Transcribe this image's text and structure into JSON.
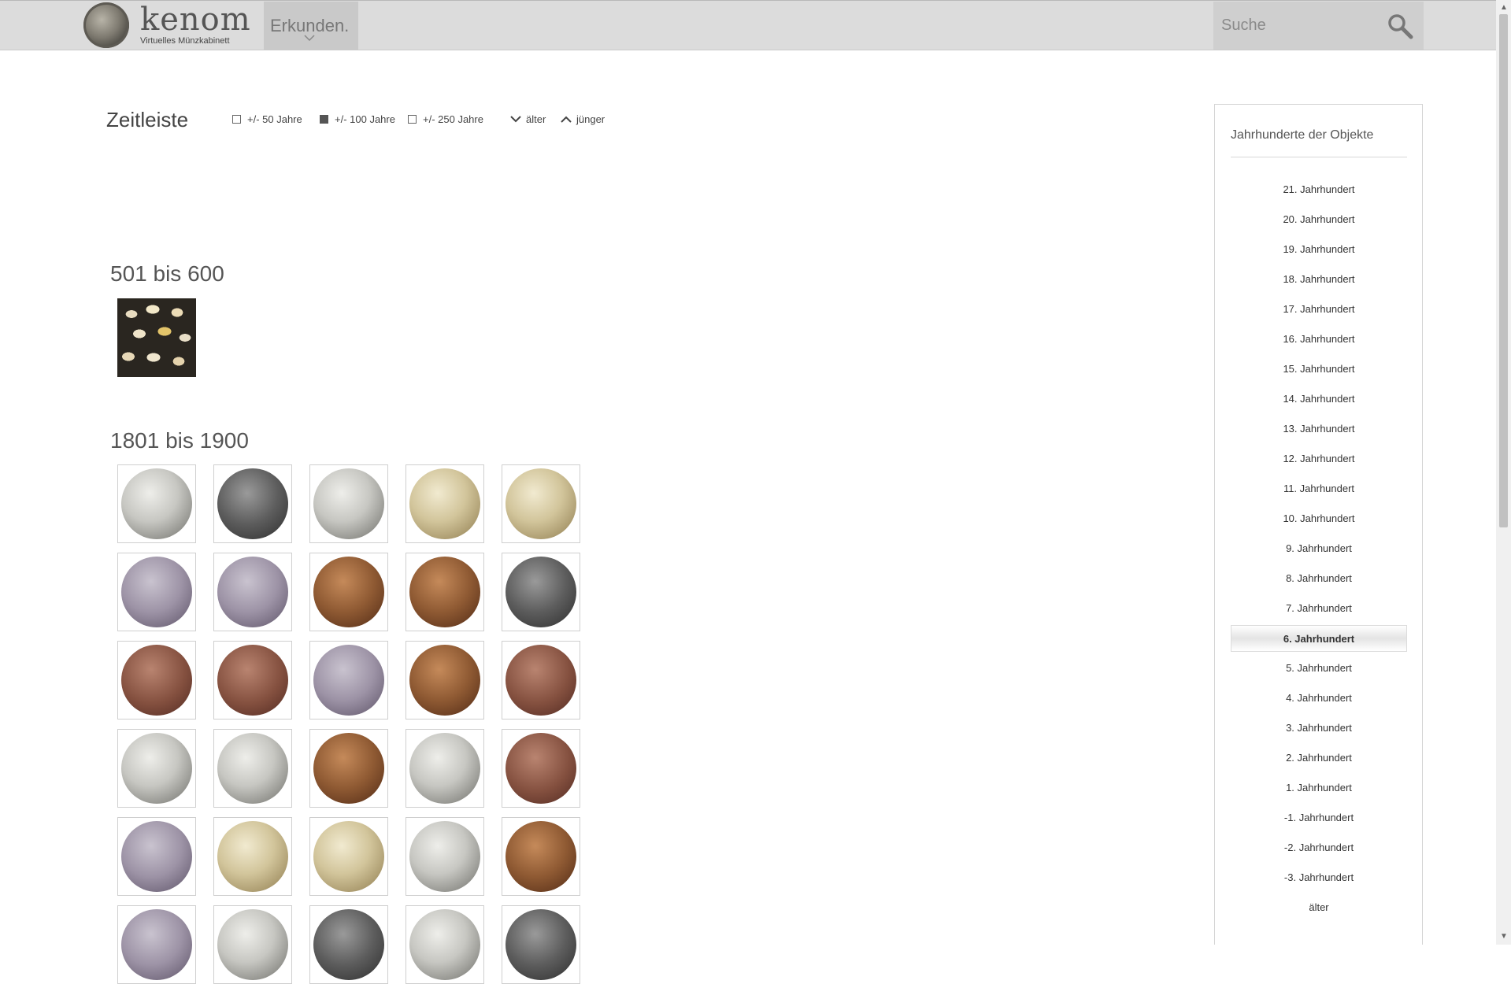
{
  "header": {
    "logo_name": "kenom",
    "logo_subtitle": "Virtuelles Münzkabinett",
    "nav_label": "Erkunden.",
    "search_placeholder": "Suche"
  },
  "timeline": {
    "title": "Zeitleiste",
    "ranges": [
      {
        "label": "+/- 50 Jahre",
        "checked": false
      },
      {
        "label": "+/- 100 Jahre",
        "checked": true
      },
      {
        "label": "+/- 250 Jahre",
        "checked": false
      }
    ],
    "older_label": "älter",
    "younger_label": "jünger"
  },
  "sections": [
    {
      "heading": "501 bis 600",
      "items": [
        "shells"
      ]
    },
    {
      "heading": "1801 bis 1900",
      "items": [
        "silver",
        "dark",
        "silver",
        "gold",
        "gold",
        "purple",
        "purple",
        "bronze",
        "bronze",
        "dark",
        "copper",
        "copper",
        "purple",
        "bronze",
        "copper",
        "silver",
        "silver",
        "bronze",
        "silver",
        "copper",
        "purple",
        "gold",
        "gold",
        "silver",
        "bronze",
        "purple",
        "silver",
        "dark",
        "silver",
        "dark"
      ]
    }
  ],
  "sidebar": {
    "title": "Jahrhunderte der Objekte",
    "centuries": [
      "21. Jahrhundert",
      "20. Jahrhundert",
      "19. Jahrhundert",
      "18. Jahrhundert",
      "17. Jahrhundert",
      "16. Jahrhundert",
      "15. Jahrhundert",
      "14. Jahrhundert",
      "13. Jahrhundert",
      "12. Jahrhundert",
      "11. Jahrhundert",
      "10. Jahrhundert",
      "9. Jahrhundert",
      "8. Jahrhundert",
      "7. Jahrhundert",
      "6. Jahrhundert",
      "5. Jahrhundert",
      "4. Jahrhundert",
      "3. Jahrhundert",
      "2. Jahrhundert",
      "1. Jahrhundert",
      "-1. Jahrhundert",
      "-2. Jahrhundert",
      "-3. Jahrhundert",
      "älter"
    ],
    "active": "6. Jahrhundert"
  }
}
